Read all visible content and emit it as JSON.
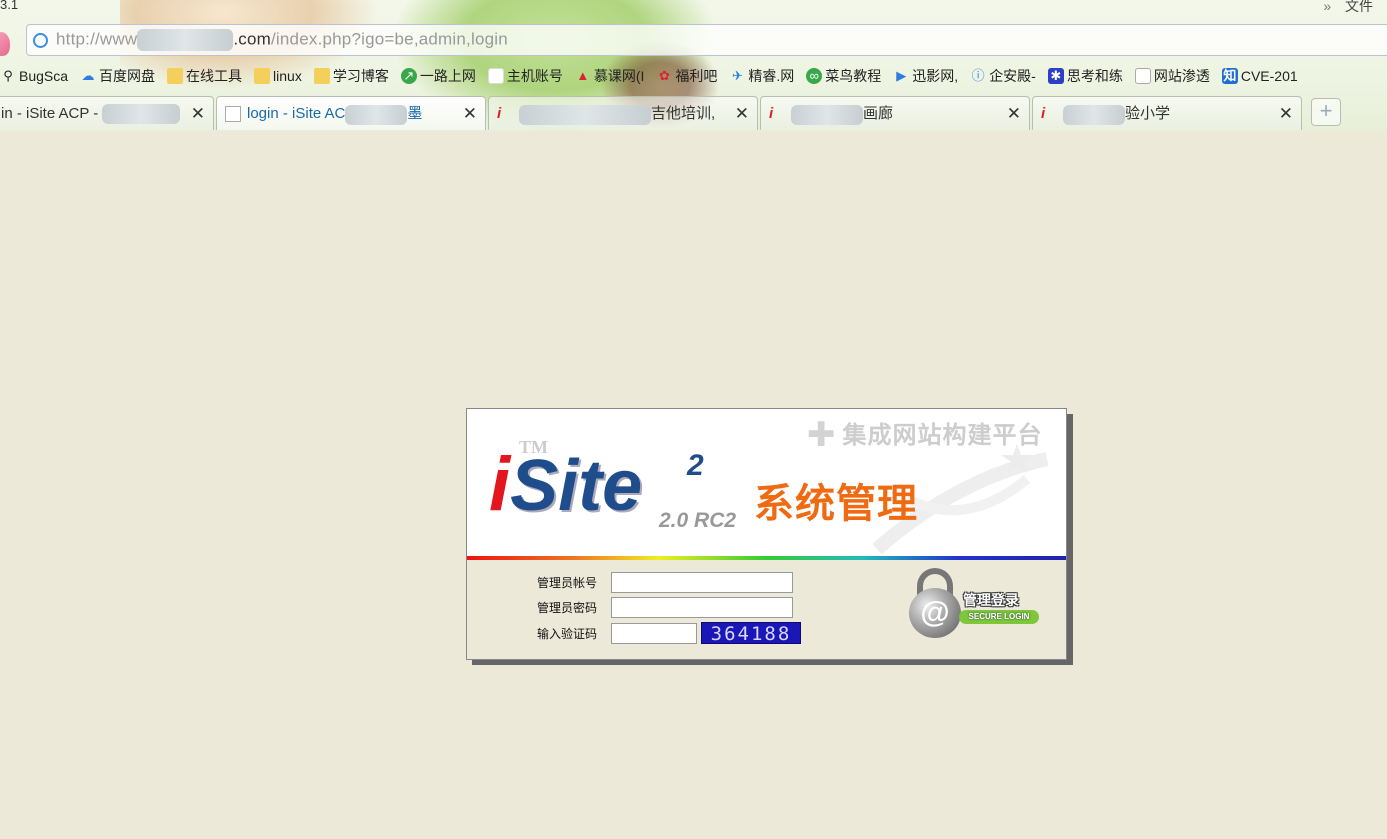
{
  "browser": {
    "title_fragment": "3.1",
    "menu_chevron": "»",
    "menu_file": "文件",
    "url": {
      "prefix": "http://www",
      "domain_suffix": ".com",
      "path": "/index.php?igo=be,admin,login"
    },
    "bookmarks": [
      {
        "label": "BugSca",
        "icon": "search-icon"
      },
      {
        "label": "百度网盘",
        "icon": "cloud-icon"
      },
      {
        "label": "在线工具",
        "icon": "folder-icon"
      },
      {
        "label": "linux",
        "icon": "folder-icon"
      },
      {
        "label": "学习博客",
        "icon": "folder-icon"
      },
      {
        "label": "一路上网",
        "icon": "site-icon"
      },
      {
        "label": "主机账号",
        "icon": "blank-page-icon"
      },
      {
        "label": "慕课网(I",
        "icon": "site-icon"
      },
      {
        "label": "福利吧",
        "icon": "site-icon"
      },
      {
        "label": "精睿.网",
        "icon": "site-icon"
      },
      {
        "label": "菜鸟教程",
        "icon": "site-icon"
      },
      {
        "label": "迅影网,",
        "icon": "site-icon"
      },
      {
        "label": "企安殿-",
        "icon": "site-icon"
      },
      {
        "label": "思考和练",
        "icon": "paw-icon"
      },
      {
        "label": "网站渗透",
        "icon": "page-icon"
      },
      {
        "label": "CVE-201",
        "icon": "zhihu-icon"
      }
    ],
    "tabs": [
      {
        "title": "in - iSite ACP -",
        "active": false
      },
      {
        "title": "login - iSite AC",
        "title_end": "墨",
        "active": true
      },
      {
        "title": "",
        "title_end": "吉他培训,",
        "active": false
      },
      {
        "title": "",
        "title_end": "画廊",
        "active": false
      },
      {
        "title": "",
        "title_end": "验小学",
        "active": false
      }
    ],
    "new_tab_symbol": "+"
  },
  "login": {
    "tagline": "集成网站构建平台",
    "logo_tm": "TM",
    "logo_i": "i",
    "logo_site": "Site",
    "logo_superscript": "2",
    "version": "2.0 RC2",
    "system_title": "系统管理",
    "fields": {
      "username_label": "管理员帐号",
      "password_label": "管理员密码",
      "captcha_label": "输入验证码",
      "username_value": "",
      "password_value": "",
      "captcha_value": ""
    },
    "captcha_image_text": "364188",
    "submit_label_zh": "管理登录",
    "submit_label_en": "SECURE LOGIN"
  },
  "colors": {
    "page_bg": "#ece9d8",
    "brand_red": "#e3161d",
    "brand_blue": "#1f4d8c",
    "title_orange": "#f06a12",
    "captcha_bg": "#1a16b8"
  }
}
